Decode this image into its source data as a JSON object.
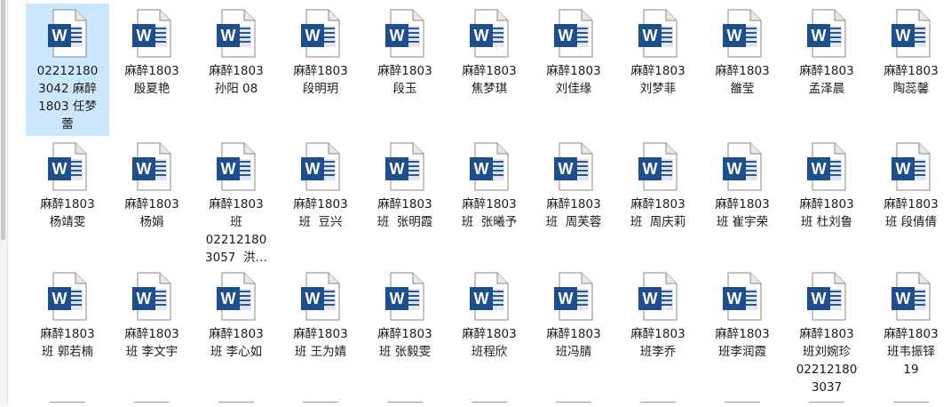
{
  "files": [
    {
      "name": "02212180\n3042 麻醉\n1803 任梦\n蕾",
      "selected": true
    },
    {
      "name": "麻醉1803\n殷夏艳"
    },
    {
      "name": "麻醉1803\n孙阳 08"
    },
    {
      "name": "麻醉1803\n段明玥"
    },
    {
      "name": "麻醉1803\n段玉"
    },
    {
      "name": "麻醉1803\n焦梦琪"
    },
    {
      "name": "麻醉1803\n刘佳缘"
    },
    {
      "name": "麻醉1803\n刘梦菲"
    },
    {
      "name": "麻醉1803\n雒莹"
    },
    {
      "name": "麻醉1803\n孟泽晨"
    },
    {
      "name": "麻醉1803\n陶蕊馨"
    },
    {
      "name": "麻醉1803\n杨靖雯"
    },
    {
      "name": "麻醉1803\n杨娟"
    },
    {
      "name": "麻醉1803\n班\n02212180\n3057  洪…"
    },
    {
      "name": "麻醉1803\n班  豆兴"
    },
    {
      "name": "麻醉1803\n班  张明霞"
    },
    {
      "name": "麻醉1803\n班  张曦予"
    },
    {
      "name": "麻醉1803\n班  周芙蓉"
    },
    {
      "name": "麻醉1803\n班  周庆莉"
    },
    {
      "name": "麻醉1803\n班 崔宇荣"
    },
    {
      "name": "麻醉1803\n班 杜刘鲁"
    },
    {
      "name": "麻醉1803\n班 段倩倩"
    },
    {
      "name": "麻醉1803\n班 郭若楠"
    },
    {
      "name": "麻醉1803\n班 李文宇"
    },
    {
      "name": "麻醉1803\n班 李心如"
    },
    {
      "name": "麻醉1803\n班 王为婧"
    },
    {
      "name": "麻醉1803\n班 张毅雯"
    },
    {
      "name": "麻醉1803\n班程欣"
    },
    {
      "name": "麻醉1803\n班冯腈"
    },
    {
      "name": "麻醉1803\n班李乔"
    },
    {
      "name": "麻醉1803\n班李润霞"
    },
    {
      "name": "麻醉1803\n班刘婉珍\n02212180\n3037"
    },
    {
      "name": "麻醉1803\n班韦振铎\n19"
    }
  ],
  "icon": {
    "name": "word-document-icon",
    "letter": "W",
    "color": "#2b579a",
    "color_dark": "#1e4e8c"
  },
  "partial_row_count": 11
}
